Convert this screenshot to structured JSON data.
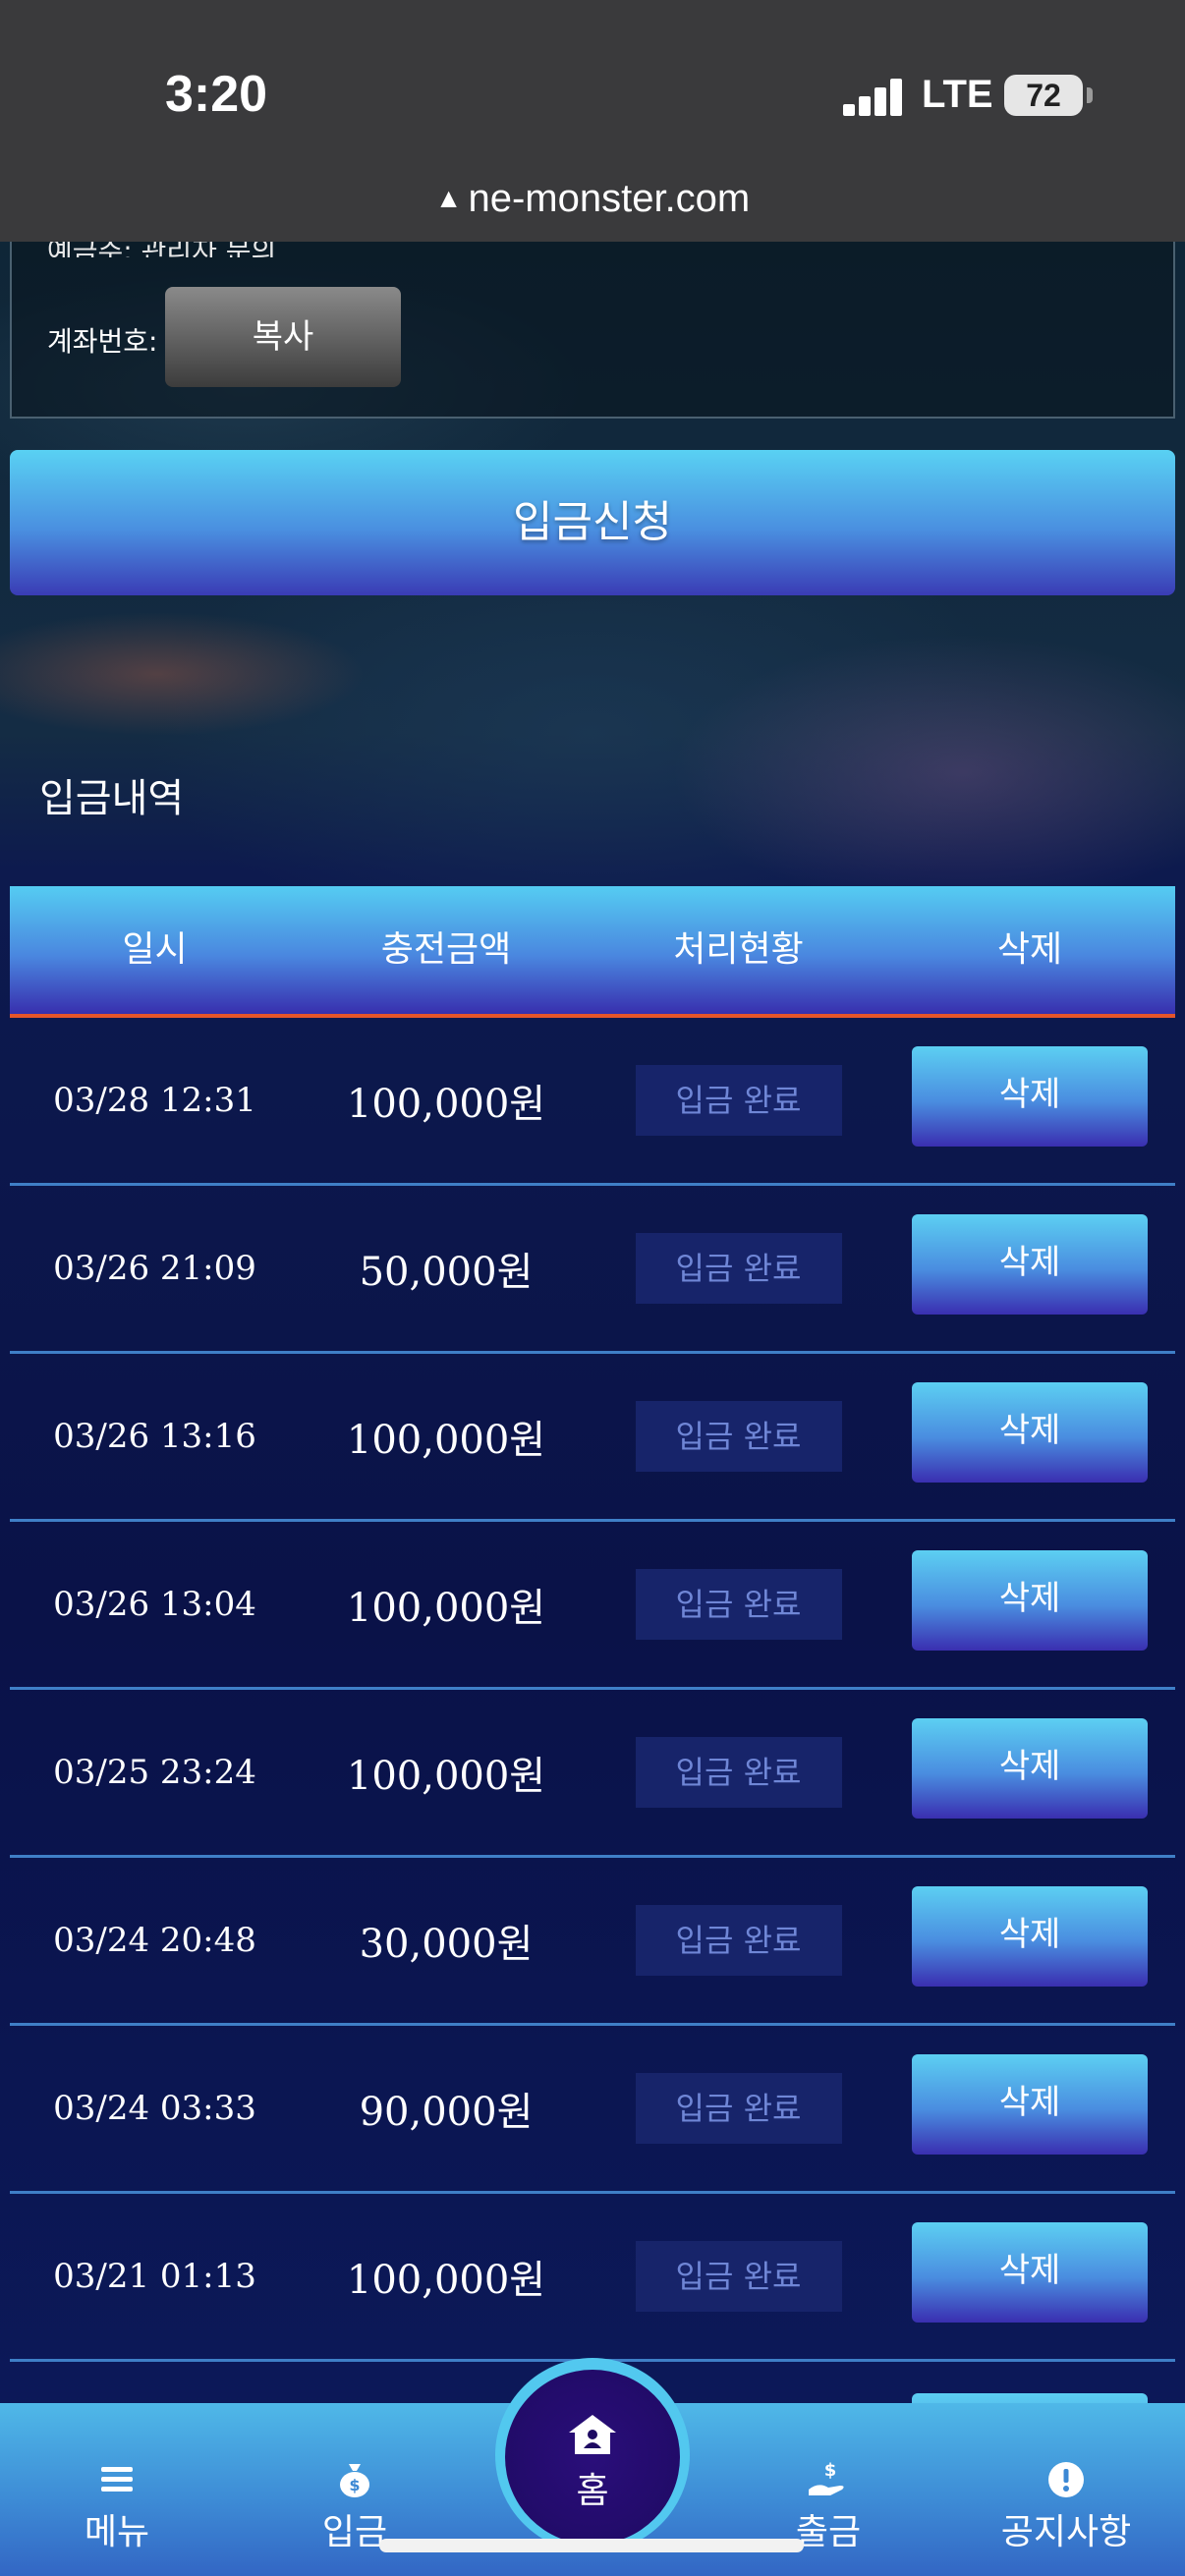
{
  "status_bar": {
    "time": "3:20",
    "network": "LTE",
    "battery": "72"
  },
  "browser": {
    "url": "ne-monster.com"
  },
  "account": {
    "depositor": "예금주: 관리자 문의",
    "account_label": "계좌번호:",
    "copy_label": "복사"
  },
  "apply_label": "입금신청",
  "history_title": "입금내역",
  "table": {
    "headers": [
      "일시",
      "충전금액",
      "처리현황",
      "삭제"
    ],
    "rows": [
      {
        "date": "03/28 12:31",
        "amount": "100,000원",
        "status": "입금 완료",
        "delete": "삭제"
      },
      {
        "date": "03/26 21:09",
        "amount": "50,000원",
        "status": "입금 완료",
        "delete": "삭제"
      },
      {
        "date": "03/26 13:16",
        "amount": "100,000원",
        "status": "입금 완료",
        "delete": "삭제"
      },
      {
        "date": "03/26 13:04",
        "amount": "100,000원",
        "status": "입금 완료",
        "delete": "삭제"
      },
      {
        "date": "03/25 23:24",
        "amount": "100,000원",
        "status": "입금 완료",
        "delete": "삭제"
      },
      {
        "date": "03/24 20:48",
        "amount": "30,000원",
        "status": "입금 완료",
        "delete": "삭제"
      },
      {
        "date": "03/24 03:33",
        "amount": "90,000원",
        "status": "입금 완료",
        "delete": "삭제"
      },
      {
        "date": "03/21 01:13",
        "amount": "100,000원",
        "status": "입금 완료",
        "delete": "삭제"
      }
    ]
  },
  "nav": {
    "menu": "메뉴",
    "deposit": "입금",
    "home": "홈",
    "withdraw": "출금",
    "notice": "공지사항"
  }
}
